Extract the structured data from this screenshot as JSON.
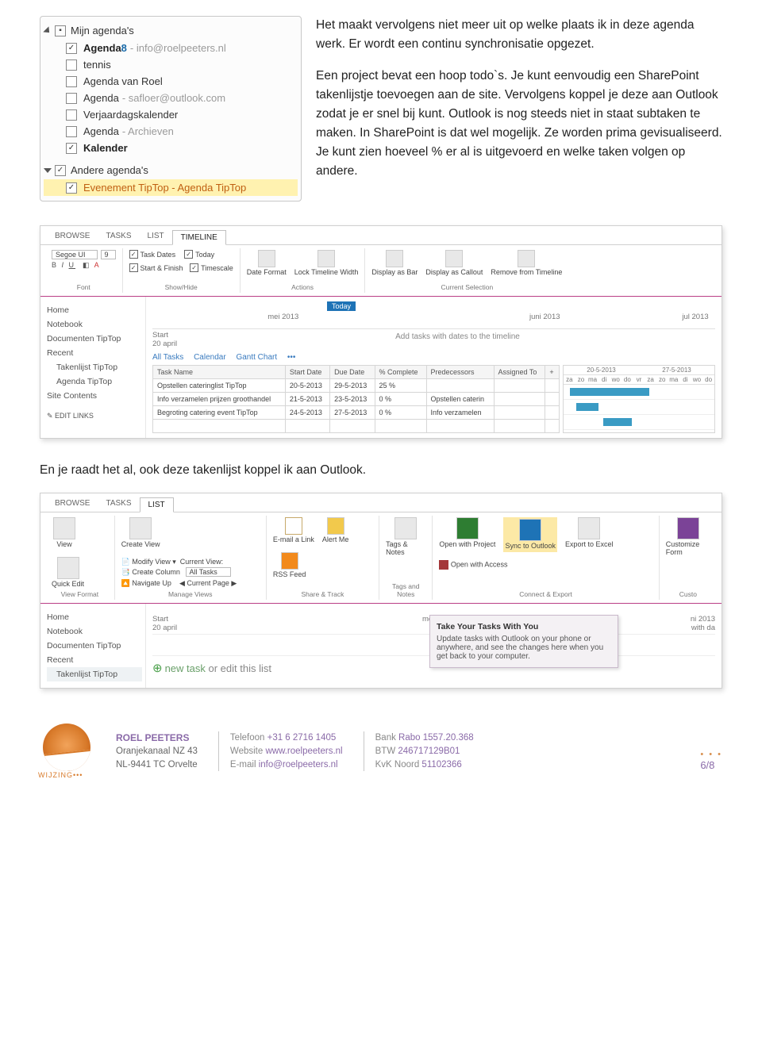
{
  "outlook_sidebar": {
    "my_calendars_label": "Mijn agenda's",
    "items": [
      {
        "label": "Agenda",
        "extra": "8",
        "hint": "- info@roelpeeters.nl",
        "checked": true,
        "bold": true
      },
      {
        "label": "tennis",
        "checked": false
      },
      {
        "label": "Agenda van Roel",
        "checked": false
      },
      {
        "label": "Agenda",
        "hint": "- safloer@outlook.com",
        "checked": false
      },
      {
        "label": "Verjaardagskalender",
        "checked": false
      },
      {
        "label": "Agenda",
        "hint": "- Archieven",
        "checked": false
      },
      {
        "label": "Kalender",
        "checked": true,
        "bold": true
      }
    ],
    "other_calendars_label": "Andere agenda's",
    "other_item": {
      "label": "Evenement TipTop - Agenda TipTop",
      "checked": true
    }
  },
  "body": {
    "p1": "Het maakt vervolgens niet meer uit op welke plaats ik in deze agenda werk. Er wordt een continu synchronisatie opgezet.",
    "p2": "Een project bevat een hoop todo`s. Je kunt eenvoudig een SharePoint takenlijstje toevoegen aan de site. Vervolgens koppel je deze aan Outlook zodat je er snel bij kunt. Outlook is nog steeds niet in staat subtaken te maken. In SharePoint is dat wel mogelijk. Ze worden prima gevisualiseerd. Je kunt zien hoeveel % er al is uitgevoerd en welke taken volgen op andere.",
    "p3": "En je raadt het al, ook deze takenlijst koppel ik aan Outlook."
  },
  "sp1": {
    "tabs": [
      "BROWSE",
      "TASKS",
      "LIST",
      "TIMELINE"
    ],
    "active_tab": "TIMELINE",
    "font_name": "Segoe UI",
    "font_size": "9",
    "checks": [
      "Task Dates",
      "Today",
      "Start & Finish",
      "Timescale"
    ],
    "ribbon_groups": {
      "font": "Font",
      "showhide": "Show/Hide",
      "actions": "Actions",
      "current": "Current Selection"
    },
    "ribbon_btns": {
      "date": "Date Format",
      "lock": "Lock Timeline Width",
      "bar": "Display as Bar",
      "callout": "Display as Callout",
      "remove": "Remove from Timeline"
    },
    "nav": [
      "Home",
      "Notebook",
      "Documenten TipTop",
      "Recent",
      "Takenlijst TipTop",
      "Agenda TipTop",
      "Site Contents",
      "✎ EDIT LINKS"
    ],
    "timeline": {
      "today": "Today",
      "months": [
        "mei 2013",
        "juni 2013",
        "jul 2013"
      ],
      "start": "Start",
      "start_date": "20 april",
      "addhint": "Add tasks with dates to the timeline"
    },
    "views": [
      "All Tasks",
      "Calendar",
      "Gantt Chart",
      "•••"
    ],
    "cols": [
      "Task Name",
      "Start Date",
      "Due Date",
      "% Complete",
      "Predecessors",
      "Assigned To",
      "+"
    ],
    "rows": [
      {
        "name": "Opstellen cateringlist TipTop",
        "start": "20-5-2013",
        "due": "29-5-2013",
        "pct": "25 %",
        "pred": "",
        "asg": ""
      },
      {
        "name": "Info verzamelen prijzen groothandel",
        "start": "21-5-2013",
        "due": "23-5-2013",
        "pct": "0 %",
        "pred": "Opstellen caterin",
        "asg": ""
      },
      {
        "name": "Begroting catering event TipTop",
        "start": "24-5-2013",
        "due": "27-5-2013",
        "pct": "0 %",
        "pred": "Info verzamelen",
        "asg": ""
      }
    ],
    "gantt": {
      "h1": "20-5-2013",
      "h2": "27-5-2013",
      "days": [
        "za",
        "zo",
        "ma",
        "di",
        "wo",
        "do",
        "vr",
        "za",
        "zo",
        "ma",
        "di",
        "wo",
        "do"
      ]
    }
  },
  "sp2": {
    "tabs": [
      "BROWSE",
      "TASKS",
      "LIST"
    ],
    "active_tab": "LIST",
    "grp_labels": {
      "vf": "View Format",
      "mv": "Manage Views",
      "st": "Share & Track",
      "tn": "Tags and Notes",
      "ce": "Connect & Export",
      "cu": "Custo"
    },
    "btns": {
      "view": "View",
      "quick": "Quick Edit",
      "create": "Create View",
      "modify": "Modify View",
      "curview_lbl": "Current View:",
      "curview_val": "All Tasks",
      "createcol": "Create Column",
      "navup": "Navigate Up",
      "curpage": "Current Page",
      "email": "E-mail a Link",
      "alert": "Alert Me",
      "rss": "RSS Feed",
      "tags": "Tags & Notes",
      "proj": "Open with Project",
      "sync": "Sync to Outlook",
      "excel": "Export to Excel",
      "access": "Open with Access",
      "custom": "Customize Form"
    },
    "nav": [
      "Home",
      "Notebook",
      "Documenten TipTop",
      "Recent",
      "Takenlijst TipTop"
    ],
    "timeline": {
      "start": "Start",
      "start_date": "20 april",
      "month": "mei 2013",
      "right": "ni 2013",
      "rhint": "with da"
    },
    "tooltip": {
      "title": "Take Your Tasks With You",
      "body": "Update tasks with Outlook on your phone or anywhere, and see the changes here when you get back to your computer."
    },
    "newtask": {
      "plus": "⊕",
      "nt": "new task",
      "rest": " or edit this list"
    }
  },
  "footer": {
    "brand": "ROEL PEETERS",
    "addr1": "Oranjekanaal NZ 43",
    "addr2": "NL-9441 TC Orvelte",
    "wij": "WIJZING•••",
    "col2": [
      [
        "Telefoon",
        "+31 6 2716 1405"
      ],
      [
        "Website",
        "www.roelpeeters.nl"
      ],
      [
        "E-mail",
        "info@roelpeeters.nl"
      ]
    ],
    "col3": [
      [
        "Bank",
        "Rabo 1557.20.368"
      ],
      [
        "BTW",
        "246717129B01"
      ],
      [
        "KvK Noord",
        "51102366"
      ]
    ],
    "page": "6/8"
  }
}
